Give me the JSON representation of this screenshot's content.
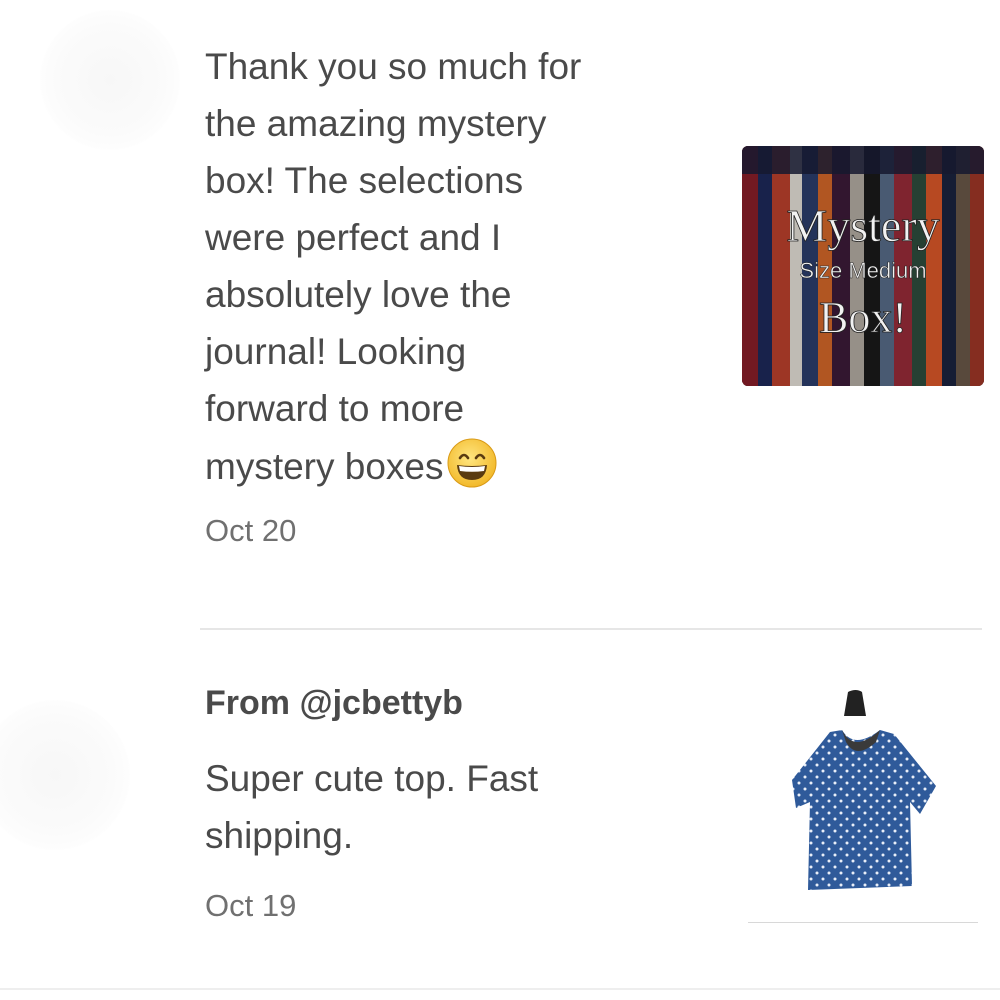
{
  "reviews": [
    {
      "message": "Thank you so much for\nthe amazing mystery\nbox! The selections\nwere perfect and I\nabsolutely love the\njournal! Looking\nforward to more\nmystery boxes",
      "emoji": "grinning-face-with-smiling-eyes",
      "date": "Oct 20",
      "thumbnail": {
        "title": "Mystery",
        "subtitle": "Size Medium",
        "title2": "Box!"
      }
    },
    {
      "from": "From @jcbettyb",
      "message": "Super cute top. Fast\nshipping.",
      "date": "Oct 19"
    }
  ]
}
